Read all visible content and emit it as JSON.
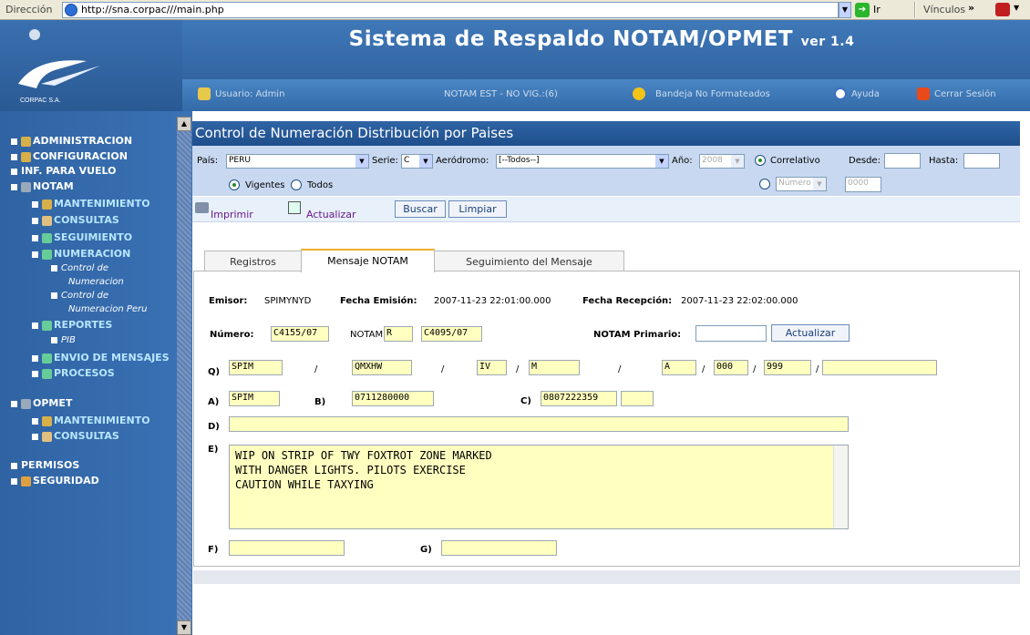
{
  "browser": {
    "address_label": "Dirección",
    "url": "http://sna.corpac///main.php",
    "go_label": "Ir",
    "links_label": "Vínculos",
    "chevron": "»"
  },
  "header": {
    "title": "Sistema de Respaldo NOTAM/OPMET",
    "version": "ver 1.4",
    "user": "Usuario: Admin",
    "notam_status": "NOTAM EST - NO VIG.:(6)",
    "inbox": "Bandeja No Formateados",
    "help": "Ayuda",
    "logout": "Cerrar Sesión"
  },
  "sidebar": {
    "items": {
      "admin": "ADMINISTRACION",
      "config": "CONFIGURACION",
      "inf": "INF. PARA VUELO",
      "notam": "NOTAM",
      "mant": "MANTENIMIENTO",
      "cons": "CONSULTAS",
      "seg": "SEGUIMIENTO",
      "num": "NUMERACION",
      "ctrl1a": "Control de",
      "ctrl1b": "Numeracion",
      "ctrl2a": "Control de",
      "ctrl2b": "Numeracion Peru",
      "rep": "REPORTES",
      "pib": "PIB",
      "envio": "ENVIO DE MENSAJES",
      "proc": "PROCESOS",
      "opmet": "OPMET",
      "mant2": "MANTENIMIENTO",
      "cons2": "CONSULTAS",
      "perm": "PERMISOS",
      "segur": "SEGURIDAD"
    }
  },
  "page": {
    "title": "Control de Numeración Distribución por Paises"
  },
  "filters": {
    "pais_label": "País:",
    "pais": "PERU",
    "serie_label": "Serie:",
    "serie": "C",
    "aerodromo_label": "Aeródromo:",
    "aerodromo": "[--Todos--]",
    "anio_label": "Año:",
    "anio": "2008",
    "correlativo_label": "Correlativo",
    "desde_label": "Desde:",
    "hasta_label": "Hasta:",
    "vigentes_label": "Vigentes",
    "todos_label": "Todos",
    "numero_select": "Número",
    "numero_value": "0000"
  },
  "toolbar": {
    "print": "Imprimir",
    "refresh": "Actualizar",
    "search": "Buscar",
    "clear": "Limpiar"
  },
  "tabs": [
    "Registros",
    "Mensaje NOTAM",
    "Seguimiento del Mensaje"
  ],
  "message": {
    "emisor_label": "Emisor:",
    "emisor": "SPIMYNYD",
    "fecha_emision_label": "Fecha Emisión:",
    "fecha_emision": "2007-11-23 22:01:00.000",
    "fecha_recepcion_label": "Fecha Recepción:",
    "fecha_recepcion": "2007-11-23 22:02:00.000",
    "numero_label": "Número:",
    "numero": "C4155/07",
    "notam_label": "NOTAM",
    "notam_type": "R",
    "notam_ref": "C4095/07",
    "primario_label": "NOTAM Primario:",
    "primario": "",
    "update_button": "Actualizar",
    "q_label": "Q)",
    "q": [
      "SPIM",
      "QMXHW",
      "IV",
      "M",
      "A",
      "000",
      "999",
      ""
    ],
    "slash": "/",
    "a_label": "A)",
    "a": "SPIM",
    "b_label": "B)",
    "b": "0711280000",
    "c_label": "C)",
    "c": "0807222359",
    "c_extra": "",
    "d_label": "D)",
    "d": "",
    "e_label": "E)",
    "e_lines": [
      "WIP ON STRIP OF TWY FOXTROT ZONE MARKED",
      "WITH DANGER LIGHTS. PILOTS EXERCISE",
      "CAUTION WHILE TAXYING"
    ],
    "f_label": "F)",
    "f": "",
    "g_label": "G)",
    "g": ""
  },
  "colors": {
    "header_blue": "#2b5a95",
    "field_yellow": "#ffffc0",
    "filter_bg": "#c8d8f0"
  }
}
